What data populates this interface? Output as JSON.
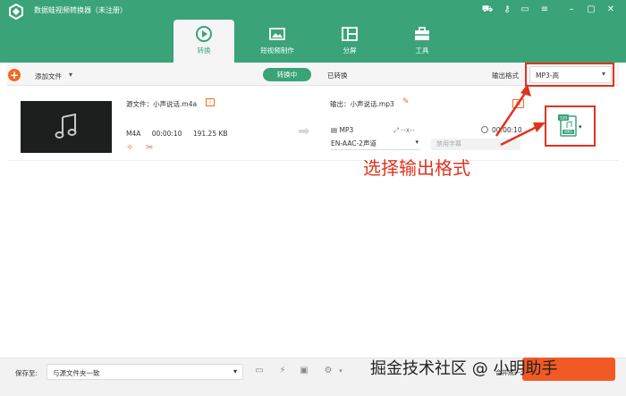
{
  "app": {
    "title": "数据蛙视频转换器（未注册）"
  },
  "nav_tabs": [
    {
      "label": "转换",
      "icon": "convert-icon",
      "active": true
    },
    {
      "label": "短视频制作",
      "icon": "mv-icon"
    },
    {
      "label": "分屏",
      "icon": "collage-icon"
    },
    {
      "label": "工具",
      "icon": "toolbox-icon"
    }
  ],
  "toolbar": {
    "add_label": "添加文件",
    "seg_converting": "转换中",
    "seg_converted": "已转换",
    "format_label": "输出格式",
    "format_value": "MP3-高"
  },
  "file": {
    "source_name": "源文件：小声说话.m4a",
    "format": "M4A",
    "duration": "00:00:10",
    "size": "191.25 KB",
    "output_name": "输出：小声说话.mp3",
    "output_format": "MP3",
    "output_resolution": "--x--",
    "output_duration": "00:00:10",
    "audio_track": "EN-AAC-2声道",
    "subtitle": "禁用字幕"
  },
  "tile": {
    "badge": "320",
    "label": "MP3"
  },
  "annotation": "选择输出格式",
  "footer": {
    "save_label": "保存至:",
    "save_path": "与源文件夹一致",
    "merge_label": "合并成一个文件"
  },
  "watermark": "掘金技术社区 @ 小明助手",
  "colors": {
    "primary": "#3aa378",
    "accent": "#f26a21",
    "annotation": "#e0331f"
  }
}
